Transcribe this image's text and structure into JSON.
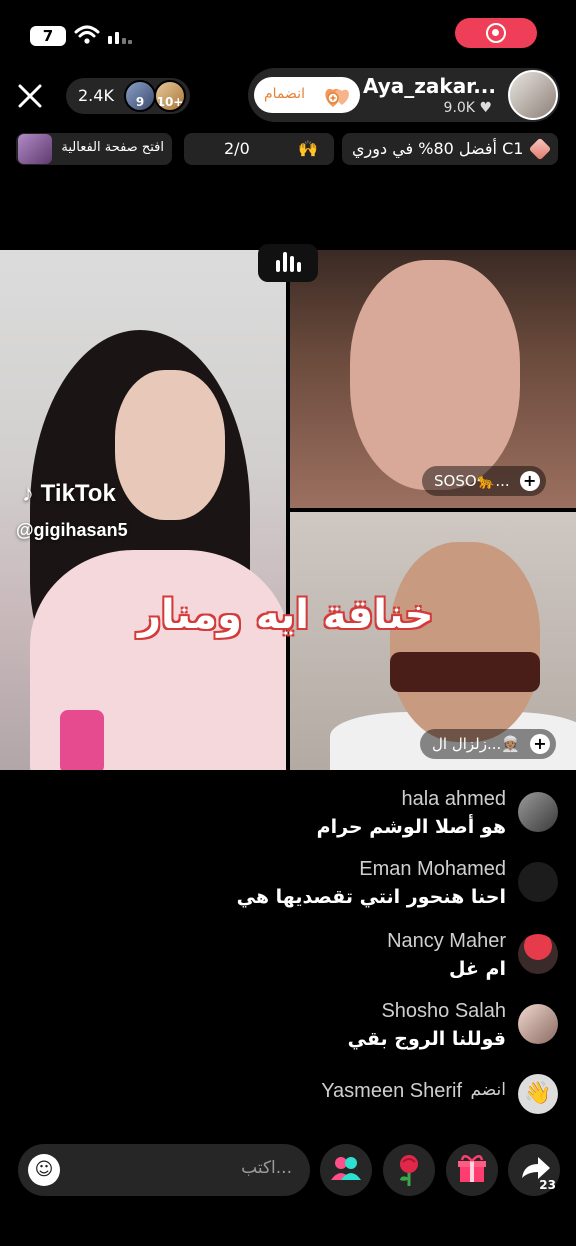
{
  "status_bar": {
    "battery": "7",
    "colors": {
      "record": "#ef3e58"
    }
  },
  "header": {
    "viewer_count": "2.4K",
    "top_viewer_badges": [
      "9",
      "10+"
    ],
    "join_label": "انضمام",
    "host_name": "Aya_zakar...",
    "host_likes": "9.0K",
    "likes_icon": "heart-icon"
  },
  "info_bar": {
    "event_label": "افتح صفحة الفعالية",
    "progress": "2/0",
    "league": "أفضل 80% في دوري C1"
  },
  "video": {
    "watermark_brand": "TikTok",
    "watermark_handle": "@gigihasan5",
    "overlay_title": "خناقة ايه ومنار",
    "guests": [
      {
        "name": "SOSO🐆..."
      },
      {
        "name": "زلزال ال...👳🏽"
      }
    ]
  },
  "comments": [
    {
      "user": "hala ahmed",
      "message": "هو أصلا الوشم حرام"
    },
    {
      "user": "Eman Mohamed",
      "message": "احنا هنحور انتي تقصديها هي"
    },
    {
      "user": "Nancy Maher",
      "message": "ام غل"
    },
    {
      "user": "Shosho Salah",
      "message": "قوللنا الروج بقي"
    },
    {
      "user": "Yasmeen Sherif",
      "message": "انضم"
    }
  ],
  "bottom_bar": {
    "input_placeholder": "اكتب...",
    "share_count": "23",
    "icons": [
      "smile-icon",
      "multi-guest-icon",
      "rose-icon",
      "gift-icon",
      "share-icon"
    ]
  }
}
